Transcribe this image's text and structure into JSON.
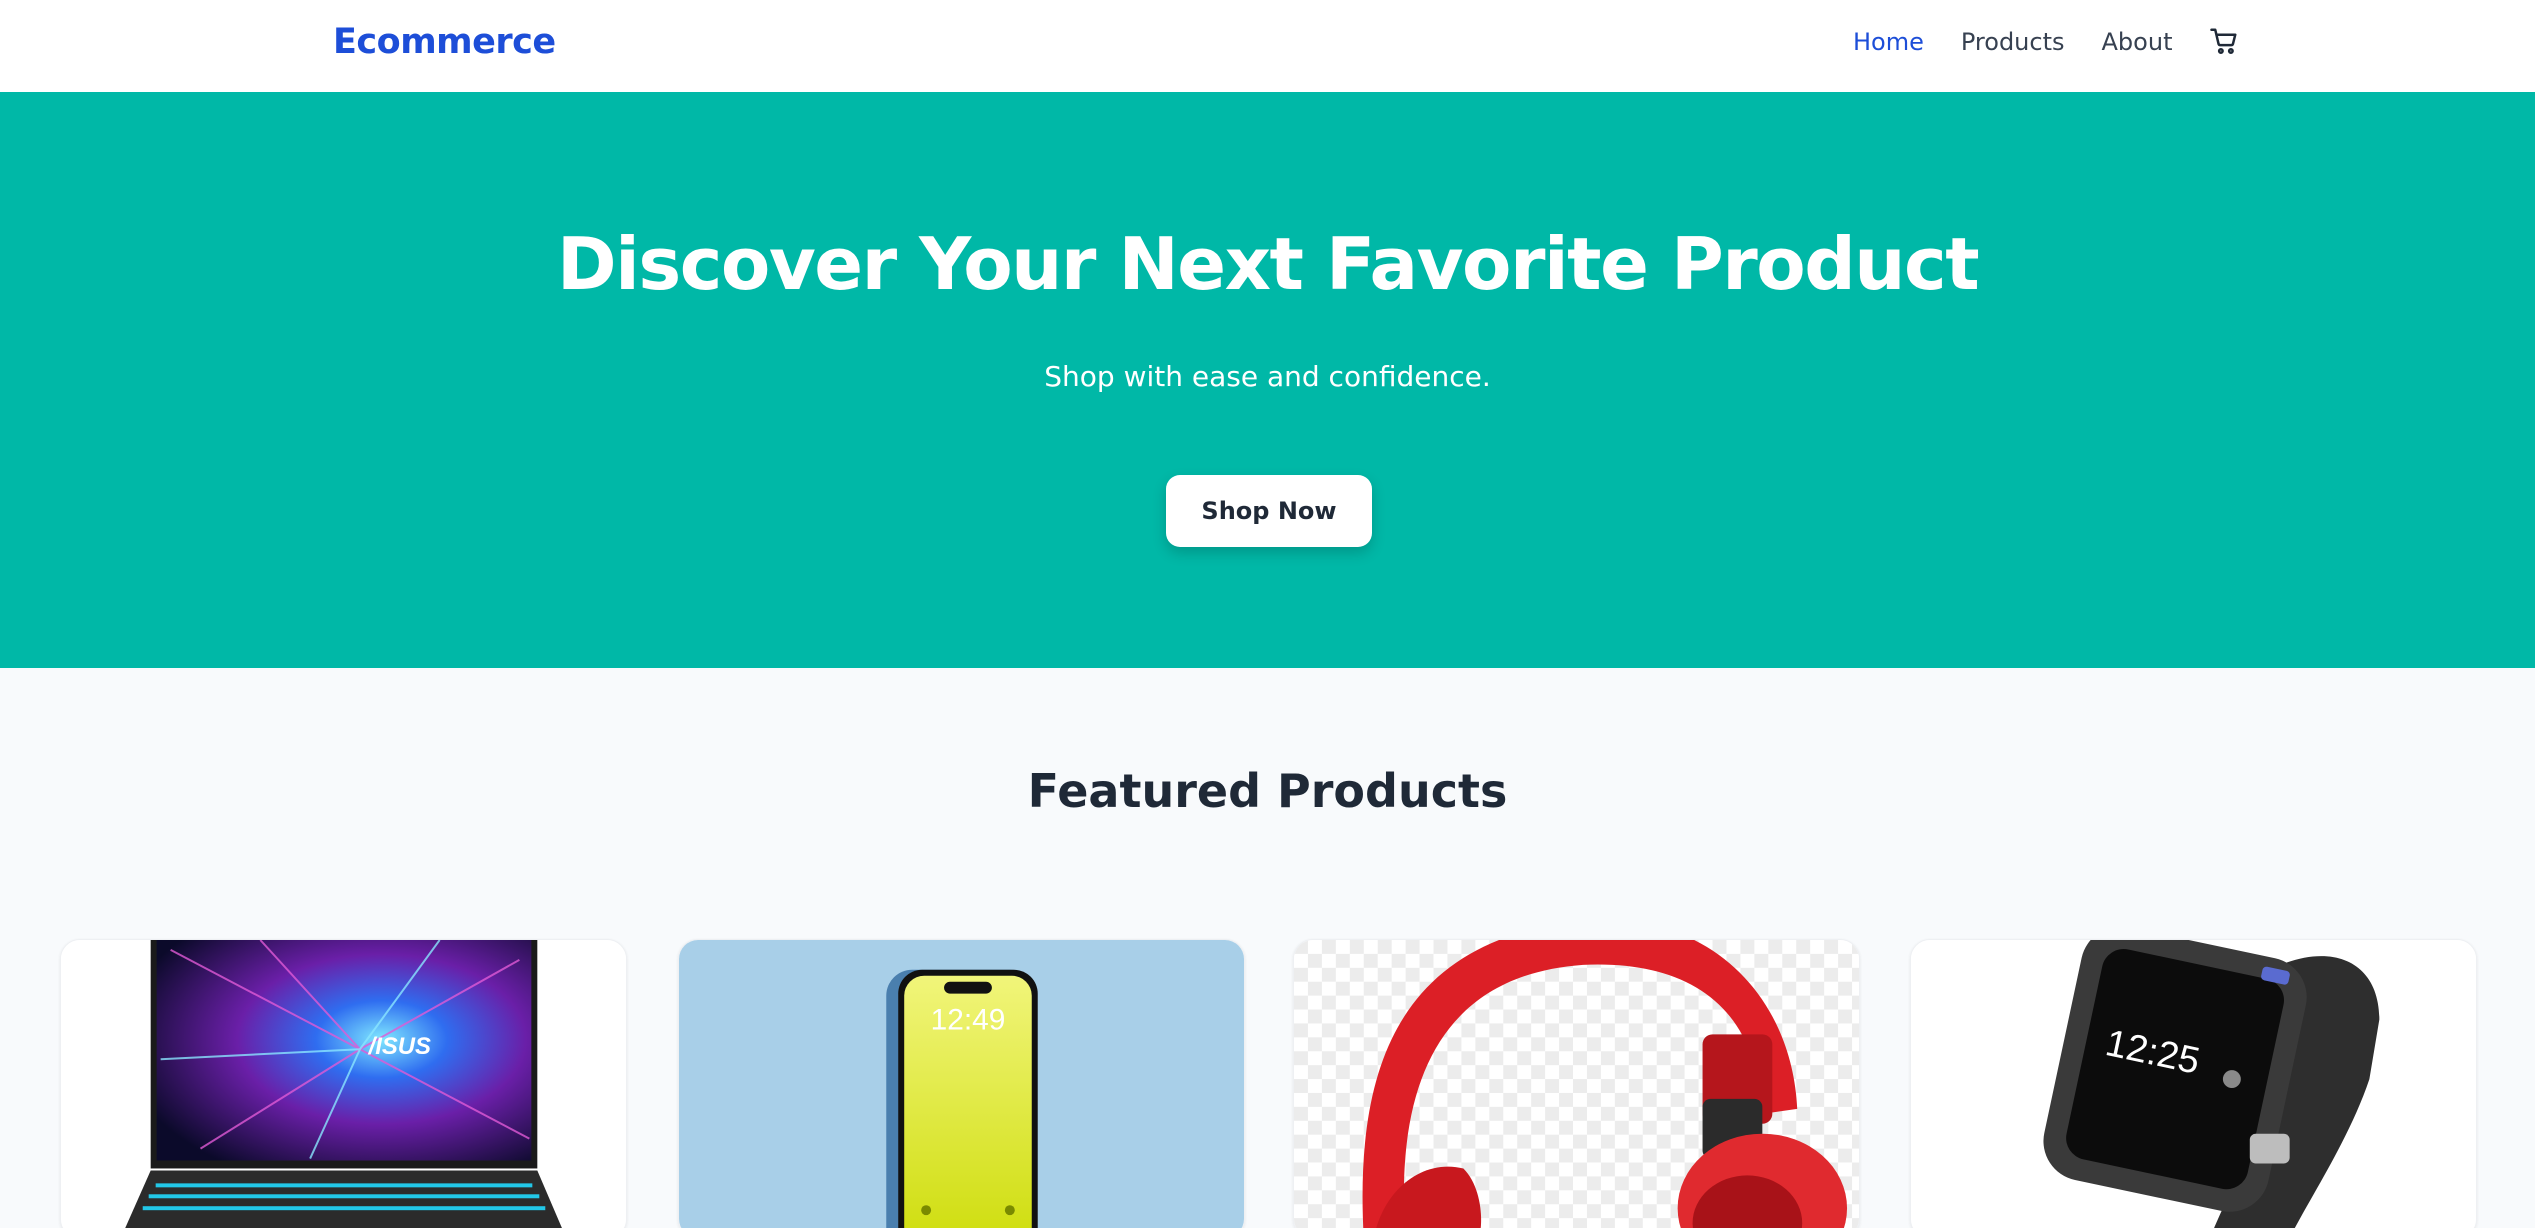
{
  "nav": {
    "logo": "Ecommerce",
    "links": [
      "Home",
      "Products",
      "About"
    ],
    "active_link": "Home",
    "cart_icon": "shopping-cart-icon"
  },
  "hero": {
    "title": "Discover Your Next Favorite Product",
    "subtitle": "Shop with ease and confidence.",
    "button_label": "Shop Now",
    "background_color": "#00b8a7"
  },
  "featured": {
    "title": "Featured Products",
    "products": [
      {
        "image": "laptop-image",
        "brand_mark": "/ISUS"
      },
      {
        "image": "smartphone-image",
        "screen_time": "12:49"
      },
      {
        "image": "headphones-image"
      },
      {
        "image": "smartwatch-image",
        "screen_time": "12:25"
      }
    ]
  },
  "colors": {
    "brand": "#1d4ed8",
    "text_dark": "#1f2937",
    "page_bg": "#f8fafc"
  }
}
